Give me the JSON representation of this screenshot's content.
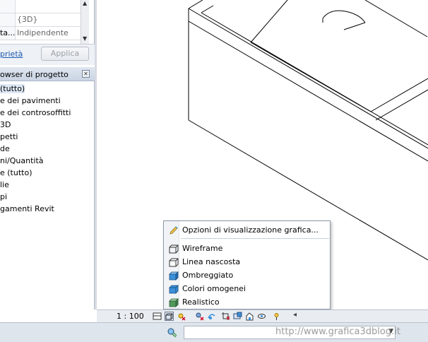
{
  "properties": {
    "rows": [
      {
        "name": "",
        "value": ""
      },
      {
        "name": "",
        "value": "{3D}"
      },
      {
        "name": "ta...",
        "value": "Indipendente"
      }
    ],
    "link_label": "prietà",
    "apply_label": "Applica"
  },
  "browser": {
    "title": "owser di progetto",
    "items": [
      {
        "label": "(tutto)",
        "selected": true
      },
      {
        "label": "e dei pavimenti",
        "selected": false
      },
      {
        "label": "e dei controsoffitti",
        "selected": false
      },
      {
        "label": "3D",
        "selected": false
      },
      {
        "label": "petti",
        "selected": false
      },
      {
        "label": "de",
        "selected": false
      },
      {
        "label": "ni/Quantità",
        "selected": false
      },
      {
        "label": "e (tutto)",
        "selected": false
      },
      {
        "label": "lie",
        "selected": false
      },
      {
        "label": "pi",
        "selected": false
      },
      {
        "label": "gamenti Revit",
        "selected": false
      }
    ]
  },
  "view_control_bar": {
    "scale": "1 : 100"
  },
  "visual_style_menu": {
    "graphics_options": "Opzioni di visualizzazione grafica...",
    "styles": [
      {
        "label": "Wireframe",
        "icon": "wireframe-cube-icon"
      },
      {
        "label": "Linea nascosta",
        "icon": "hidden-line-cube-icon"
      },
      {
        "label": "Ombreggiato",
        "icon": "shaded-cube-icon"
      },
      {
        "label": "Colori omogenei",
        "icon": "consistent-colors-cube-icon"
      },
      {
        "label": "Realistico",
        "icon": "realistic-cube-icon"
      }
    ]
  },
  "status_bar": {
    "watermark": "http://www.grafica3dblog.it"
  },
  "colors": {
    "panel_bg": "#eef1f5",
    "header_bg": "#c9d4e3",
    "link": "#1a5ab0",
    "cube_blue": "#3a8fd9"
  }
}
